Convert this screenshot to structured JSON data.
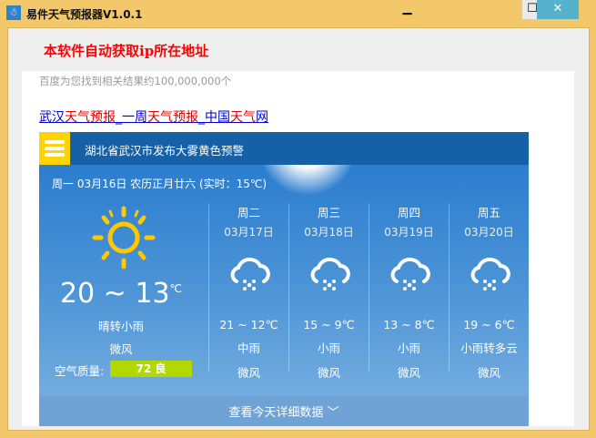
{
  "window": {
    "title": "易件天气预报器V1.0.1",
    "min": "▁",
    "max": "☐",
    "close": "✕"
  },
  "notice": "本软件自动获取ip所在地址",
  "search": {
    "count": "百度为您找到相关结果约100,000,000个",
    "link_parts": [
      {
        "t": "武汉",
        "red": false
      },
      {
        "t": "天气预报",
        "red": true
      },
      {
        "t": "_一周",
        "red": false
      },
      {
        "t": "天气预报",
        "red": true
      },
      {
        "t": "_中国",
        "red": false
      },
      {
        "t": "天气",
        "red": true
      },
      {
        "t": "网",
        "red": false
      }
    ]
  },
  "weather": {
    "alert": "湖北省武汉市发布大雾黄色预警",
    "date": "周一 03月16日 农历正月廿六 (实时：15℃)",
    "today": {
      "icon": "sun-icon",
      "temp": "20 ~ 13",
      "unit": "℃",
      "desc": "晴转小雨",
      "wind": "微风",
      "aq_label": "空气质量:",
      "aq_value": "72 良",
      "aq_color": "#b3d800"
    },
    "days": [
      {
        "name": "周二",
        "date": "03月17日",
        "icon": "rain-cloud-icon",
        "temp": "21 ~ 12℃",
        "desc": "中雨",
        "wind": "微风"
      },
      {
        "name": "周三",
        "date": "03月18日",
        "icon": "rain-cloud-icon",
        "temp": "15 ~ 9℃",
        "desc": "小雨",
        "wind": "微风"
      },
      {
        "name": "周四",
        "date": "03月19日",
        "icon": "rain-cloud-icon",
        "temp": "13 ~ 8℃",
        "desc": "小雨",
        "wind": "微风"
      },
      {
        "name": "周五",
        "date": "03月20日",
        "icon": "rain-cloud-icon",
        "temp": "19 ~ 6℃",
        "desc": "小雨转多云",
        "wind": "微风"
      }
    ],
    "more": "查看今天详细数据"
  }
}
